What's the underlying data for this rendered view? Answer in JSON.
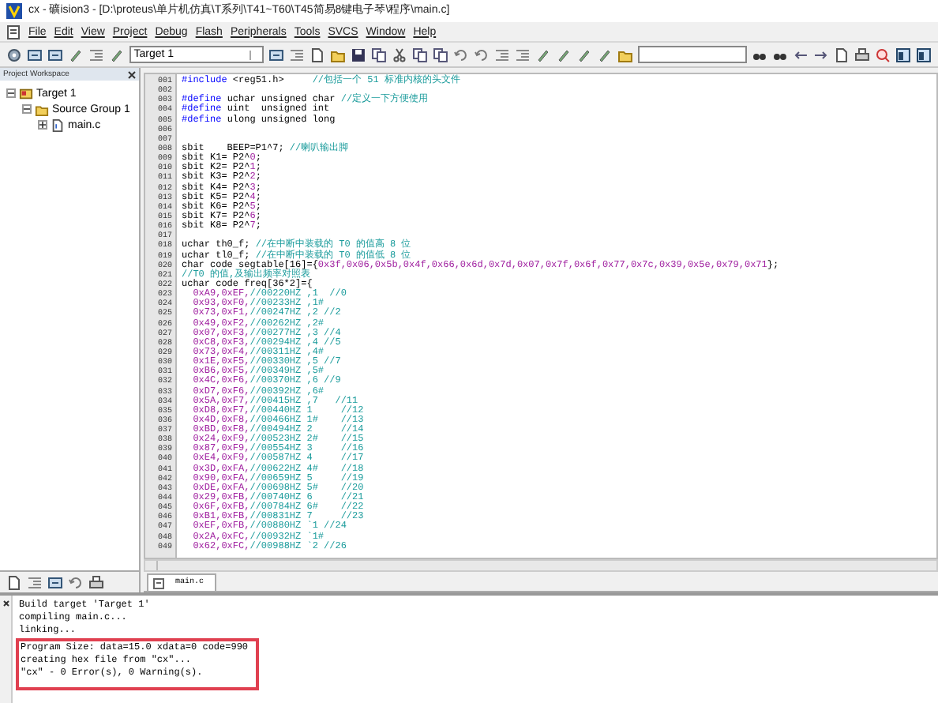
{
  "window": {
    "title": "cx - 礦ision3 - [D:\\proteus\\单片机仿真\\T系列\\T41~T60\\T45简易8键电子琴\\程序\\main.c]"
  },
  "menu": [
    "File",
    "Edit",
    "View",
    "Project",
    "Debug",
    "Flash",
    "Peripherals",
    "Tools",
    "SVCS",
    "Window",
    "Help"
  ],
  "toolbar": {
    "target": "Target 1"
  },
  "workspace": {
    "title": "Project Workspace",
    "tree": [
      {
        "label": "Target 1",
        "kind": "target",
        "expanded": true,
        "children": [
          {
            "label": "Source Group 1",
            "kind": "group",
            "expanded": true,
            "children": [
              {
                "label": "main.c",
                "kind": "file",
                "expanded": false
              }
            ]
          }
        ]
      }
    ]
  },
  "editor": {
    "tab": "main.c",
    "lines": [
      {
        "number": "001",
        "segments": [
          {
            "kind": "keyword",
            "text": "#include"
          },
          {
            "kind": "plain",
            "text": " <reg51.h>     "
          },
          {
            "kind": "comment",
            "text": "//包括一个 51 标准内核的头文件"
          }
        ]
      },
      {
        "number": "002"
      },
      {
        "number": "003",
        "segments": [
          {
            "kind": "keyword",
            "text": "#define"
          },
          {
            "kind": "plain",
            "text": " uchar unsigned char "
          },
          {
            "kind": "comment",
            "text": "//定义一下方便使用"
          }
        ]
      },
      {
        "number": "004",
        "segments": [
          {
            "kind": "keyword",
            "text": "#define"
          },
          {
            "kind": "plain",
            "text": " uint  unsigned int"
          }
        ]
      },
      {
        "number": "005",
        "segments": [
          {
            "kind": "keyword",
            "text": "#define"
          },
          {
            "kind": "plain",
            "text": " ulong unsigned long"
          }
        ]
      },
      {
        "number": "006"
      },
      {
        "number": "007"
      },
      {
        "number": "008",
        "segments": [
          {
            "kind": "plain",
            "text": "sbit    BEEP=P1^7; "
          },
          {
            "kind": "comment",
            "text": "//喇叭输出脚"
          }
        ]
      },
      {
        "number": "009",
        "segments": [
          {
            "kind": "plain",
            "text": "sbit K1= P2^"
          },
          {
            "kind": "number",
            "text": "0"
          },
          {
            "kind": "plain",
            "text": ";"
          }
        ]
      },
      {
        "number": "010",
        "segments": [
          {
            "kind": "plain",
            "text": "sbit K2= P2^"
          },
          {
            "kind": "number",
            "text": "1"
          },
          {
            "kind": "plain",
            "text": ";"
          }
        ]
      },
      {
        "number": "011",
        "segments": [
          {
            "kind": "plain",
            "text": "sbit K3= P2^"
          },
          {
            "kind": "number",
            "text": "2"
          },
          {
            "kind": "plain",
            "text": ";"
          }
        ]
      },
      {
        "number": "012",
        "segments": [
          {
            "kind": "plain",
            "text": "sbit K4= P2^"
          },
          {
            "kind": "number",
            "text": "3"
          },
          {
            "kind": "plain",
            "text": ";"
          }
        ]
      },
      {
        "number": "013",
        "segments": [
          {
            "kind": "plain",
            "text": "sbit K5= P2^"
          },
          {
            "kind": "number",
            "text": "4"
          },
          {
            "kind": "plain",
            "text": ";"
          }
        ]
      },
      {
        "number": "014",
        "segments": [
          {
            "kind": "plain",
            "text": "sbit K6= P2^"
          },
          {
            "kind": "number",
            "text": "5"
          },
          {
            "kind": "plain",
            "text": ";"
          }
        ]
      },
      {
        "number": "015",
        "segments": [
          {
            "kind": "plain",
            "text": "sbit K7= P2^"
          },
          {
            "kind": "number",
            "text": "6"
          },
          {
            "kind": "plain",
            "text": ";"
          }
        ]
      },
      {
        "number": "016",
        "segments": [
          {
            "kind": "plain",
            "text": "sbit K8= P2^"
          },
          {
            "kind": "number",
            "text": "7"
          },
          {
            "kind": "plain",
            "text": ";"
          }
        ]
      },
      {
        "number": "017"
      },
      {
        "number": "018",
        "segments": [
          {
            "kind": "plain",
            "text": "uchar th0_f; "
          },
          {
            "kind": "comment",
            "text": "//在中断中装载的 T0 的值高 8 位"
          }
        ]
      },
      {
        "number": "019",
        "segments": [
          {
            "kind": "plain",
            "text": "uchar tl0_f; "
          },
          {
            "kind": "comment",
            "text": "//在中断中装载的 T0 的值低 8 位"
          }
        ]
      },
      {
        "number": "020",
        "segments": [
          {
            "kind": "plain",
            "text": "char code segtable[16]={"
          },
          {
            "kind": "number",
            "text": "0x3f,0x06,0x5b,0x4f,0x66,0x6d,0x7d,0x07,0x7f,0x6f,0x77,0x7c,0x39,0x5e,0x79,0x71"
          },
          {
            "kind": "plain",
            "text": "};"
          }
        ]
      },
      {
        "number": "021",
        "segments": [
          {
            "kind": "comment",
            "text": "//T0 的值,及输出频率对照表"
          }
        ]
      },
      {
        "number": "022",
        "segments": [
          {
            "kind": "plain",
            "text": "uchar code freq[36*2]={"
          }
        ]
      },
      {
        "number": "023",
        "segments": [
          {
            "kind": "number",
            "text": "  0xA9,0xEF,"
          },
          {
            "kind": "comment",
            "text": "//00220HZ ,1  //0"
          }
        ]
      },
      {
        "number": "024",
        "segments": [
          {
            "kind": "number",
            "text": "  0x93,0xF0,"
          },
          {
            "kind": "comment",
            "text": "//00233HZ ,1#"
          }
        ]
      },
      {
        "number": "025",
        "segments": [
          {
            "kind": "number",
            "text": "  0x73,0xF1,"
          },
          {
            "kind": "comment",
            "text": "//00247HZ ,2 //2"
          }
        ]
      },
      {
        "number": "026",
        "segments": [
          {
            "kind": "number",
            "text": "  0x49,0xF2,"
          },
          {
            "kind": "comment",
            "text": "//00262HZ ,2#"
          }
        ]
      },
      {
        "number": "027",
        "segments": [
          {
            "kind": "number",
            "text": "  0x07,0xF3,"
          },
          {
            "kind": "comment",
            "text": "//00277HZ ,3 //4"
          }
        ]
      },
      {
        "number": "028",
        "segments": [
          {
            "kind": "number",
            "text": "  0xC8,0xF3,"
          },
          {
            "kind": "comment",
            "text": "//00294HZ ,4 //5"
          }
        ]
      },
      {
        "number": "029",
        "segments": [
          {
            "kind": "number",
            "text": "  0x73,0xF4,"
          },
          {
            "kind": "comment",
            "text": "//00311HZ ,4#"
          }
        ]
      },
      {
        "number": "030",
        "segments": [
          {
            "kind": "number",
            "text": "  0x1E,0xF5,"
          },
          {
            "kind": "comment",
            "text": "//00330HZ ,5 //7"
          }
        ]
      },
      {
        "number": "031",
        "segments": [
          {
            "kind": "number",
            "text": "  0xB6,0xF5,"
          },
          {
            "kind": "comment",
            "text": "//00349HZ ,5#"
          }
        ]
      },
      {
        "number": "032",
        "segments": [
          {
            "kind": "number",
            "text": "  0x4C,0xF6,"
          },
          {
            "kind": "comment",
            "text": "//00370HZ ,6 //9"
          }
        ]
      },
      {
        "number": "033",
        "segments": [
          {
            "kind": "number",
            "text": "  0xD7,0xF6,"
          },
          {
            "kind": "comment",
            "text": "//00392HZ ,6#"
          }
        ]
      },
      {
        "number": "034",
        "segments": [
          {
            "kind": "number",
            "text": "  0x5A,0xF7,"
          },
          {
            "kind": "comment",
            "text": "//00415HZ ,7   //11"
          }
        ]
      },
      {
        "number": "035",
        "segments": [
          {
            "kind": "number",
            "text": "  0xD8,0xF7,"
          },
          {
            "kind": "comment",
            "text": "//00440HZ 1     //12"
          }
        ]
      },
      {
        "number": "036",
        "segments": [
          {
            "kind": "number",
            "text": "  0x4D,0xF8,"
          },
          {
            "kind": "comment",
            "text": "//00466HZ 1#    //13"
          }
        ]
      },
      {
        "number": "037",
        "segments": [
          {
            "kind": "number",
            "text": "  0xBD,0xF8,"
          },
          {
            "kind": "comment",
            "text": "//00494HZ 2     //14"
          }
        ]
      },
      {
        "number": "038",
        "segments": [
          {
            "kind": "number",
            "text": "  0x24,0xF9,"
          },
          {
            "kind": "comment",
            "text": "//00523HZ 2#    //15"
          }
        ]
      },
      {
        "number": "039",
        "segments": [
          {
            "kind": "number",
            "text": "  0x87,0xF9,"
          },
          {
            "kind": "comment",
            "text": "//00554HZ 3     //16"
          }
        ]
      },
      {
        "number": "040",
        "segments": [
          {
            "kind": "number",
            "text": "  0xE4,0xF9,"
          },
          {
            "kind": "comment",
            "text": "//00587HZ 4     //17"
          }
        ]
      },
      {
        "number": "041",
        "segments": [
          {
            "kind": "number",
            "text": "  0x3D,0xFA,"
          },
          {
            "kind": "comment",
            "text": "//00622HZ 4#    //18"
          }
        ]
      },
      {
        "number": "042",
        "segments": [
          {
            "kind": "number",
            "text": "  0x90,0xFA,"
          },
          {
            "kind": "comment",
            "text": "//00659HZ 5     //19"
          }
        ]
      },
      {
        "number": "043",
        "segments": [
          {
            "kind": "number",
            "text": "  0xDE,0xFA,"
          },
          {
            "kind": "comment",
            "text": "//00698HZ 5#    //20"
          }
        ]
      },
      {
        "number": "044",
        "segments": [
          {
            "kind": "number",
            "text": "  0x29,0xFB,"
          },
          {
            "kind": "comment",
            "text": "//00740HZ 6     //21"
          }
        ]
      },
      {
        "number": "045",
        "segments": [
          {
            "kind": "number",
            "text": "  0x6F,0xFB,"
          },
          {
            "kind": "comment",
            "text": "//00784HZ 6#    //22"
          }
        ]
      },
      {
        "number": "046",
        "segments": [
          {
            "kind": "number",
            "text": "  0xB1,0xFB,"
          },
          {
            "kind": "comment",
            "text": "//00831HZ 7     //23"
          }
        ]
      },
      {
        "number": "047",
        "segments": [
          {
            "kind": "number",
            "text": "  0xEF,0xFB,"
          },
          {
            "kind": "comment",
            "text": "//00880HZ `1 //24"
          }
        ]
      },
      {
        "number": "048",
        "segments": [
          {
            "kind": "number",
            "text": "  0x2A,0xFC,"
          },
          {
            "kind": "comment",
            "text": "//00932HZ `1#"
          }
        ]
      },
      {
        "number": "049",
        "segments": [
          {
            "kind": "number",
            "text": "  0x62,0xFC,"
          },
          {
            "kind": "comment",
            "text": "//00988HZ `2 //26"
          }
        ]
      }
    ]
  },
  "output": {
    "lines": [
      {
        "text": "Build target 'Target 1'",
        "highlighted": false
      },
      {
        "text": "compiling main.c...",
        "highlighted": false
      },
      {
        "text": "linking...",
        "highlighted": false
      },
      {
        "text": "Program Size: data=15.0 xdata=0 code=990",
        "highlighted": true
      },
      {
        "text": "creating hex file from \"cx\"...",
        "highlighted": true
      },
      {
        "text": "\"cx\" - 0 Error(s), 0 Warning(s).",
        "highlighted": true
      }
    ]
  }
}
